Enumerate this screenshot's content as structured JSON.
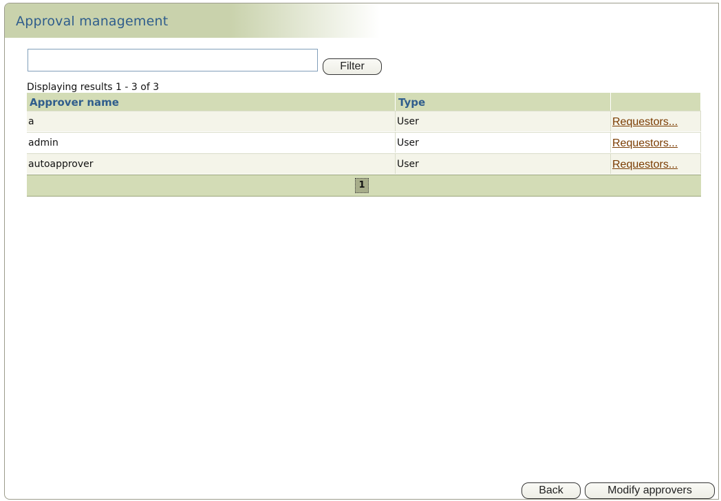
{
  "header": {
    "title": "Approval management"
  },
  "filter": {
    "value": "",
    "placeholder": "",
    "button_label": "Filter"
  },
  "results": {
    "summary": "Displaying results 1 - 3 of 3"
  },
  "table": {
    "columns": [
      "Approver name",
      "Type",
      ""
    ],
    "rows": [
      {
        "name": "a",
        "type": "User",
        "action": "Requestors..."
      },
      {
        "name": "admin",
        "type": "User",
        "action": "Requestors..."
      },
      {
        "name": "autoapprover",
        "type": "User",
        "action": "Requestors..."
      }
    ]
  },
  "pagination": {
    "current_page": "1"
  },
  "footer": {
    "back_label": "Back",
    "modify_label": "Modify approvers"
  },
  "colors": {
    "title_text": "#2f5d8c",
    "header_bg": "#d3dcb6",
    "link": "#7a3b00"
  }
}
